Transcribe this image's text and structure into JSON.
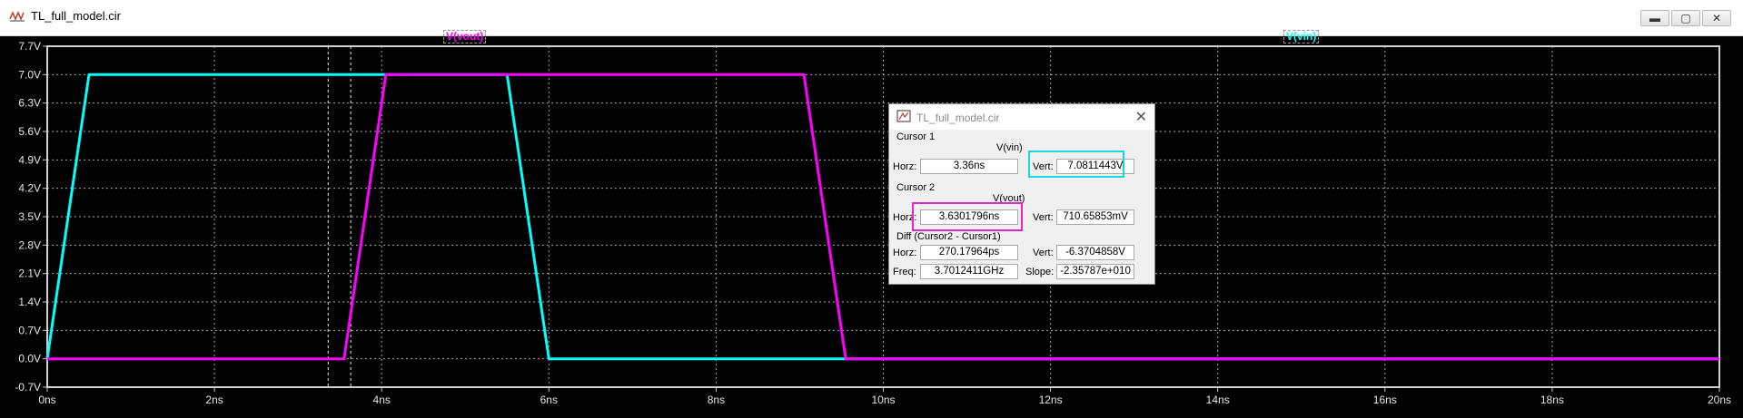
{
  "window": {
    "title": "TL_full_model.cir",
    "buttons": {
      "minimize": "▬",
      "maximize": "▢",
      "close": "✕"
    }
  },
  "traces": [
    {
      "name": "V(vout)",
      "color": "#ff00ff"
    },
    {
      "name": "V(vin)",
      "color": "#00ffff"
    }
  ],
  "chart_data": {
    "type": "line",
    "xlim": [
      0,
      20
    ],
    "ylim": [
      -0.7,
      7.7
    ],
    "x_unit": "ns",
    "y_unit": "V",
    "grid": true,
    "x_ticks": [
      "0ns",
      "2ns",
      "4ns",
      "6ns",
      "8ns",
      "10ns",
      "12ns",
      "14ns",
      "16ns",
      "18ns",
      "20ns"
    ],
    "y_ticks": [
      "7.7V",
      "7.0V",
      "6.3V",
      "5.6V",
      "4.9V",
      "4.2V",
      "3.5V",
      "2.8V",
      "2.1V",
      "1.4V",
      "0.7V",
      "0.0V",
      "-0.7V"
    ],
    "series": [
      {
        "name": "V(vin)",
        "color": "#00ffff",
        "x": [
          0,
          0.5,
          5.5,
          6.0,
          20
        ],
        "y": [
          0,
          7.0,
          7.0,
          0,
          0
        ]
      },
      {
        "name": "V(vout)",
        "color": "#ff00ff",
        "x": [
          0,
          3.55,
          4.05,
          9.05,
          9.55,
          20
        ],
        "y": [
          0,
          0,
          7.0,
          7.0,
          0,
          0
        ]
      }
    ],
    "cursors": [
      {
        "x": 3.36
      },
      {
        "x": 3.63
      }
    ]
  },
  "cursor_dialog": {
    "title": "TL_full_model.cir",
    "cursor1": {
      "heading": "Cursor 1",
      "trace": "V(vin)",
      "horz_label": "Horz:",
      "horz": "3.36ns",
      "vert_label": "Vert:",
      "vert": "7.0811443V"
    },
    "cursor2": {
      "heading": "Cursor 2",
      "trace": "V(vout)",
      "horz_label": "Horz:",
      "horz": "3.6301796ns",
      "vert_label": "Vert:",
      "vert": "710.65853mV"
    },
    "diff": {
      "heading": "Diff (Cursor2 - Cursor1)",
      "horz_label": "Horz:",
      "horz": "270.17964ps",
      "vert_label": "Vert:",
      "vert": "-6.3704858V",
      "freq_label": "Freq:",
      "freq": "3.7012411GHz",
      "slope_label": "Slope:",
      "slope": "-2.35787e+010"
    }
  }
}
